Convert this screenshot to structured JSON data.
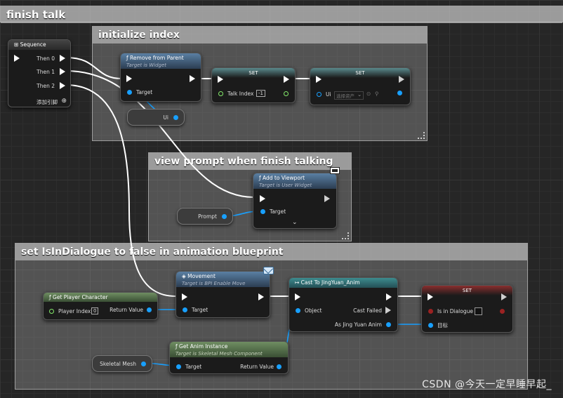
{
  "graph_title": "finish talk",
  "comments": {
    "init": "initialize index",
    "prompt": "view prompt when finish talking",
    "dialogue": "set IsInDialogue to false in animation blueprint"
  },
  "sequence": {
    "title": "Sequence",
    "then0": "Then 0",
    "then1": "Then 1",
    "then2": "Then 2",
    "add_pin": "添加引脚"
  },
  "remove_from_parent": {
    "title": "Remove from Parent",
    "subtitle": "Target is Widget",
    "target": "Target"
  },
  "ui_var": "Ui",
  "set_talk_index": {
    "title": "SET",
    "pin": "Talk Index",
    "value": "-1"
  },
  "set_ui": {
    "title": "SET",
    "pin": "Ui",
    "value": "选择资产"
  },
  "add_to_viewport": {
    "title": "Add to Viewport",
    "subtitle": "Target is User Widget",
    "target": "Target"
  },
  "prompt_var": "Prompt",
  "get_player_character": {
    "title": "Get Player Character",
    "player_index": "Player Index",
    "player_index_value": "0",
    "return_value": "Return Value"
  },
  "movement": {
    "title": "Movement",
    "subtitle": "Target is BPI Enable Move",
    "target": "Target"
  },
  "cast": {
    "title": "Cast To JingYuan_Anim",
    "object": "Object",
    "cast_failed": "Cast Failed",
    "as": "As Jing Yuan Anim"
  },
  "set_dialogue": {
    "title": "SET",
    "pin": "Is in Dialogue",
    "target": "目标"
  },
  "get_anim_instance": {
    "title": "Get Anim Instance",
    "subtitle": "Target is Skeletal Mesh Component",
    "target": "Target",
    "return_value": "Return Value"
  },
  "skeletal_mesh_var": "Skeletal Mesh",
  "watermark": "CSDN @今天一定早睡早起_",
  "colors": {
    "wire_exec": "#ffffff",
    "wire_object": "#18a0ff",
    "background": "#262626"
  }
}
